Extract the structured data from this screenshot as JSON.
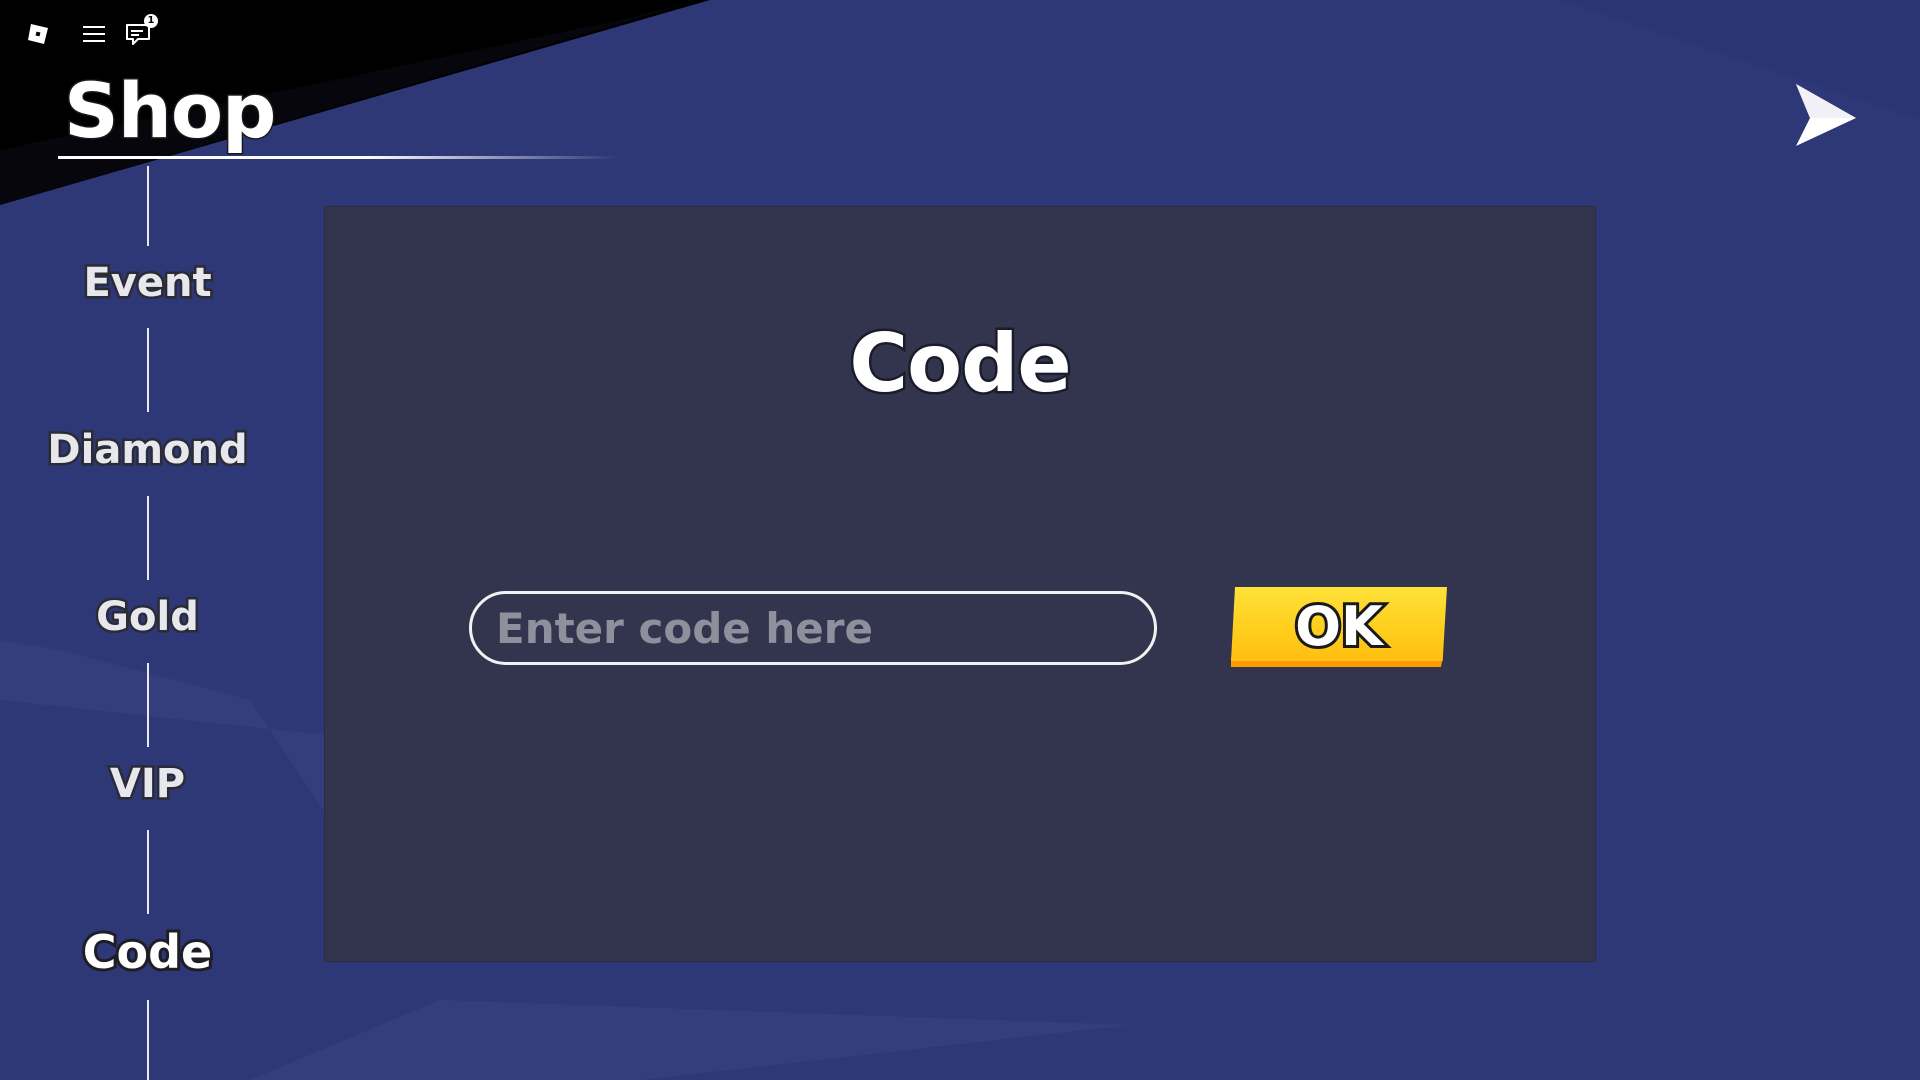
{
  "topbar": {
    "notification_count": "1",
    "icons": [
      "roblox-logo-icon",
      "hamburger-menu-icon",
      "chat-icon"
    ]
  },
  "shop": {
    "title": "Shop"
  },
  "sidebar": {
    "items": [
      {
        "label": "Event",
        "active": false
      },
      {
        "label": "Diamond",
        "active": false
      },
      {
        "label": "Gold",
        "active": false
      },
      {
        "label": "VIP",
        "active": false
      },
      {
        "label": "Code",
        "active": true
      }
    ]
  },
  "panel": {
    "title": "Code",
    "input": {
      "placeholder": "Enter code here",
      "value": ""
    },
    "ok_label": "OK"
  },
  "colors": {
    "background": "#2e3877",
    "panel": "#33354f",
    "ok_button": "#ffd21f",
    "ok_shadow": "#ff9a00"
  }
}
